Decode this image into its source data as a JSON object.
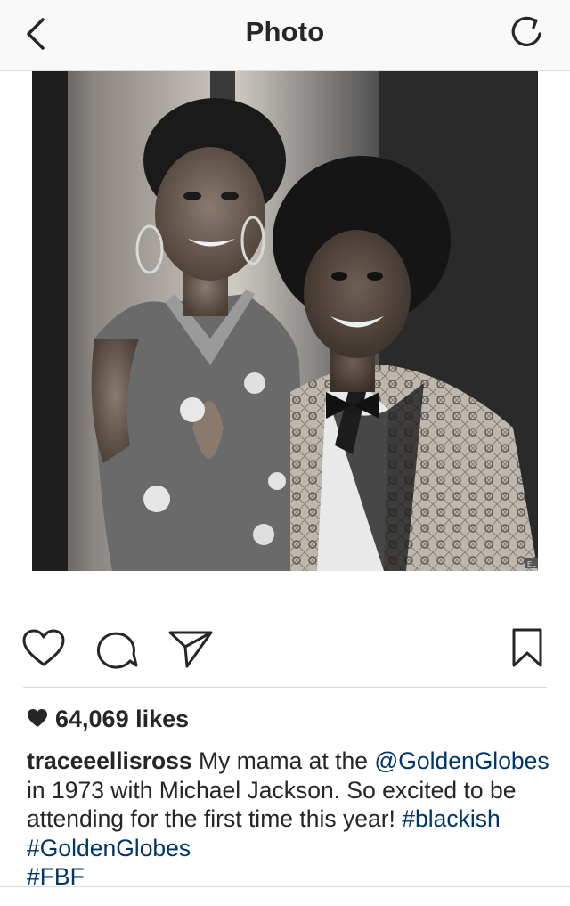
{
  "header": {
    "title": "Photo",
    "back_icon": "chevron-left-icon",
    "refresh_icon": "refresh-icon"
  },
  "post": {
    "image_description_icon": "photo",
    "image_watermark": "EL",
    "actions": {
      "like_icon": "heart-outline-icon",
      "comment_icon": "comment-icon",
      "share_icon": "paper-plane-icon",
      "save_icon": "bookmark-icon"
    },
    "likes": "64,069 likes",
    "caption": {
      "username": "traceeellisross",
      "text_1": " My mama at the ",
      "mention": "@GoldenGlobes",
      "text_2": " in 1973 with Michael Jackson. So excited to be attending for the first time this year! ",
      "hashtag_1": "#blackish",
      "space": " ",
      "hashtag_2": "#GoldenGlobes",
      "hashtag_3": "#FBF"
    }
  },
  "colors": {
    "text": "#262626",
    "link": "#003569",
    "border": "#dbdbdb",
    "header_bg": "#f9f9f9"
  }
}
